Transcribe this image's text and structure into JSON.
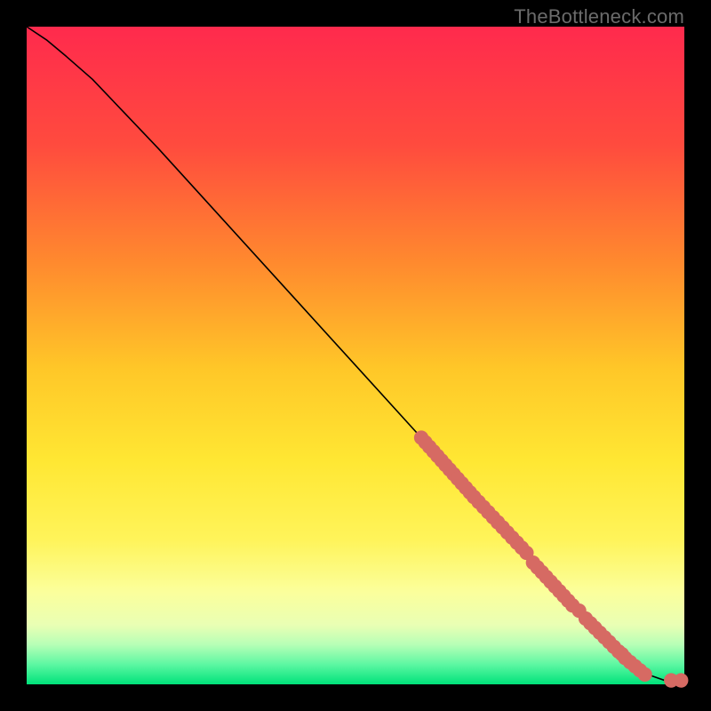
{
  "watermark": "TheBottleneck.com",
  "colors": {
    "curve": "#000000",
    "dot_fill": "#d66a63",
    "dot_stroke": "#a84a44",
    "frame": "#000000"
  },
  "gradient_stops": [
    {
      "pct": 0,
      "color": "#ff2a4d"
    },
    {
      "pct": 18,
      "color": "#ff4b3e"
    },
    {
      "pct": 36,
      "color": "#ff8a2e"
    },
    {
      "pct": 52,
      "color": "#ffc728"
    },
    {
      "pct": 66,
      "color": "#ffe733"
    },
    {
      "pct": 78,
      "color": "#fff45a"
    },
    {
      "pct": 86,
      "color": "#fbff9c"
    },
    {
      "pct": 91,
      "color": "#e9ffb4"
    },
    {
      "pct": 94,
      "color": "#b6ffb6"
    },
    {
      "pct": 97,
      "color": "#5cf7a2"
    },
    {
      "pct": 100,
      "color": "#00e27a"
    }
  ],
  "chart_data": {
    "type": "line",
    "title": "",
    "xlabel": "",
    "ylabel": "",
    "xlim": [
      0,
      100
    ],
    "ylim": [
      0,
      100
    ],
    "series": [
      {
        "name": "curve",
        "x": [
          0,
          3,
          6,
          10,
          20,
          30,
          40,
          50,
          60,
          70,
          80,
          90,
          95,
          97,
          100
        ],
        "y": [
          100,
          98,
          95.5,
          92,
          81.5,
          70.5,
          59.5,
          48.5,
          37.5,
          26.5,
          15.5,
          5,
          1.3,
          0.6,
          0.6
        ]
      }
    ],
    "dot_clusters": [
      {
        "x_start": 60,
        "x_end": 68,
        "y_start": 37.5,
        "y_end": 28.5,
        "count": 14
      },
      {
        "x_start": 68,
        "x_end": 76,
        "y_start": 28.5,
        "y_end": 20.0,
        "count": 12
      },
      {
        "x_start": 77,
        "x_end": 83,
        "y_start": 18.5,
        "y_end": 12.0,
        "count": 10
      },
      {
        "x_start": 85,
        "x_end": 90,
        "y_start": 10.0,
        "y_end": 5.0,
        "count": 8
      },
      {
        "x_start": 91,
        "x_end": 94,
        "y_start": 4.0,
        "y_end": 1.5,
        "count": 5
      }
    ],
    "isolated_dots": [
      {
        "x": 84.0,
        "y": 11.2
      },
      {
        "x": 90.5,
        "y": 4.6
      },
      {
        "x": 98.0,
        "y": 0.6
      },
      {
        "x": 99.5,
        "y": 0.6
      }
    ],
    "dot_radius_data_units": 1.1
  }
}
